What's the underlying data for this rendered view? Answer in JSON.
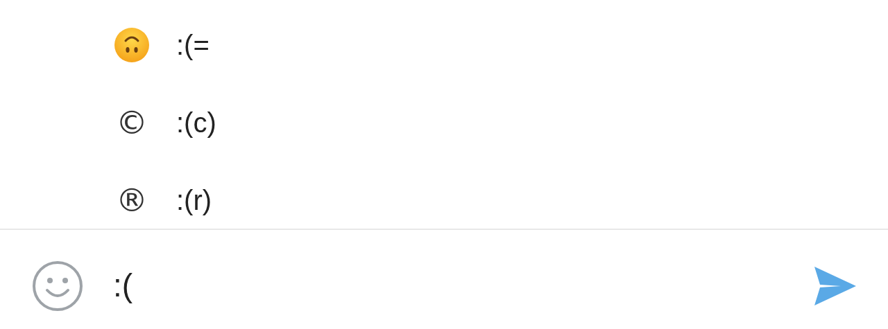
{
  "suggestions": [
    {
      "kind": "face",
      "code": ":(="
    },
    {
      "kind": "glyph",
      "symbol": "©",
      "code": ":(c)"
    },
    {
      "kind": "glyph",
      "symbol": "®",
      "code": ":(r)"
    }
  ],
  "composer": {
    "value": ":("
  }
}
